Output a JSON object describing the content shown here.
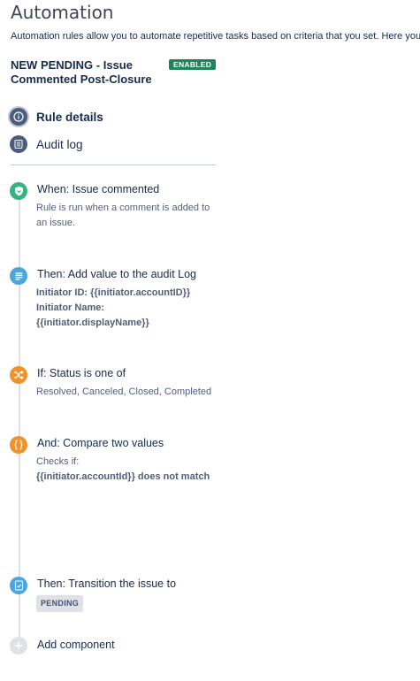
{
  "header": {
    "title": "Automation",
    "description": "Automation rules allow you to automate repetitive tasks based on criteria that you set. Here you"
  },
  "rule": {
    "name": "NEW PENDING - Issue Commented Post-Closure",
    "status": "ENABLED"
  },
  "nav": {
    "rule_details": "Rule details",
    "audit_log": "Audit log"
  },
  "colors": {
    "trigger": "#36b37e",
    "action": "#4ba6dc",
    "condition": "#f0922b",
    "enabled": "#1f845a"
  },
  "steps": [
    {
      "title": "When: Issue commented",
      "line1": "Rule is run when a comment is added to",
      "line2": "an issue.",
      "icon": "shield-icon"
    },
    {
      "title": "Then: Add value to the audit Log",
      "line1": "Initiator ID: {{initiator.accountID}}",
      "line2": "Initiator Name:",
      "line3": "{{initiator.displayName}}",
      "icon": "document-icon"
    },
    {
      "title": "If: Status is one of",
      "line1": "Resolved, Canceled, Closed, Completed",
      "icon": "shuffle-icon"
    },
    {
      "title": "And: Compare two values",
      "line1": "Checks if:",
      "line2": "{{initiator.accountId}} does not match",
      "icon": "braces-icon"
    },
    {
      "title": "Then: Transition the issue to",
      "status": "PENDING",
      "icon": "transition-icon"
    }
  ],
  "add_component": "Add component"
}
